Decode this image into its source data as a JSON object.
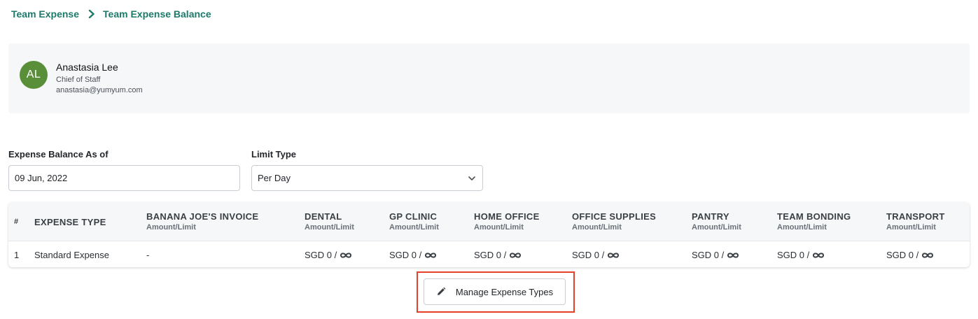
{
  "breadcrumb": {
    "items": [
      "Team Expense",
      "Team Expense Balance"
    ]
  },
  "profile": {
    "initials": "AL",
    "name": "Anastasia Lee",
    "role": "Chief of Staff",
    "email": "anastasia@yumyum.com",
    "avatar_color": "#5a8f3a"
  },
  "filters": {
    "balance_label": "Expense Balance As of",
    "balance_value": "09 Jun, 2022",
    "limit_label": "Limit Type",
    "limit_value": "Per Day"
  },
  "table": {
    "columns": [
      {
        "label": "#",
        "sub": ""
      },
      {
        "label": "EXPENSE TYPE",
        "sub": ""
      },
      {
        "label": "BANANA JOE'S INVOICE",
        "sub": "Amount/Limit"
      },
      {
        "label": "DENTAL",
        "sub": "Amount/Limit"
      },
      {
        "label": "GP CLINIC",
        "sub": "Amount/Limit"
      },
      {
        "label": "HOME OFFICE",
        "sub": "Amount/Limit"
      },
      {
        "label": "OFFICE SUPPLIES",
        "sub": "Amount/Limit"
      },
      {
        "label": "PANTRY",
        "sub": "Amount/Limit"
      },
      {
        "label": "TEAM BONDING",
        "sub": "Amount/Limit"
      },
      {
        "label": "TRANSPORT",
        "sub": "Amount/Limit"
      }
    ],
    "rows": [
      {
        "index": "1",
        "type": "Standard Expense",
        "cells": [
          "-",
          "SGD 0 /",
          "SGD 0 /",
          "SGD 0 /",
          "SGD 0 /",
          "SGD 0 /",
          "SGD 0 /",
          "SGD 0 /"
        ]
      }
    ]
  },
  "actions": {
    "manage_label": "Manage Expense Types"
  },
  "colors": {
    "accent": "#1b7a6a",
    "highlight": "#e4402a"
  }
}
